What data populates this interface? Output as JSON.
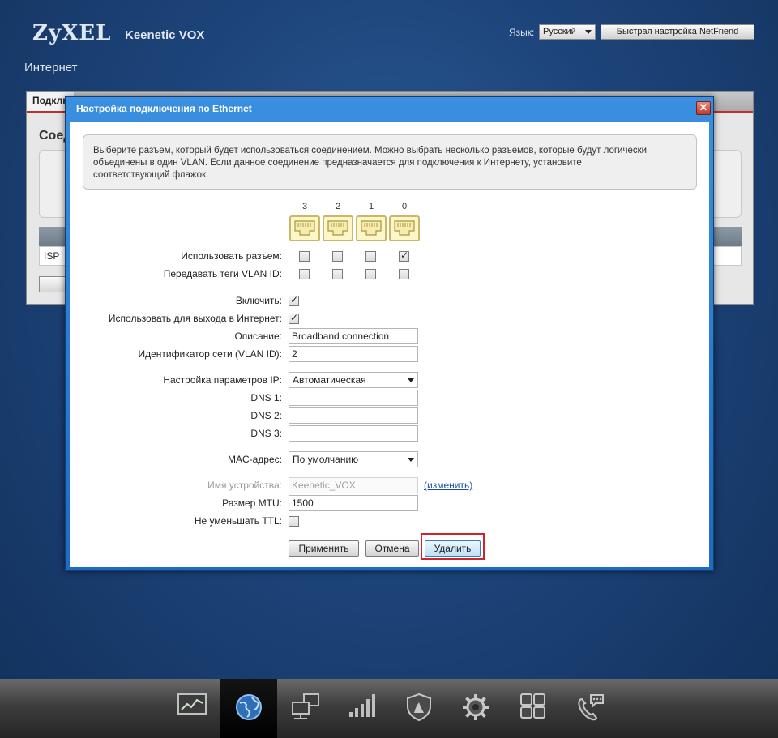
{
  "header": {
    "brand": "ZyXEL",
    "model": "Keenetic VOX",
    "language_label": "Язык:",
    "language_value": "Русский",
    "netfriend_button": "Быстрая настройка NetFriend",
    "page_title": "Интернет"
  },
  "background_panel": {
    "tab": "Подклю",
    "heading": "Соед",
    "table_row": "ISP"
  },
  "dialog": {
    "title": "Настройка подключения по Ethernet",
    "close": "✕",
    "info_lines": [
      "Выберите разъем, который будет использоваться соединением. Можно выбрать несколько разъемов, которые будут логически",
      "объединены в один VLAN. Если данное соединение предназначается для подключения к Интернету, установите",
      "соответствующий флажок."
    ],
    "ports": [
      "3",
      "2",
      "1",
      "0"
    ],
    "use_port_label": "Использовать разъем:",
    "use_port_checked": [
      false,
      false,
      false,
      true
    ],
    "vlan_tags_label": "Передавать теги VLAN ID:",
    "vlan_tags_checked": [
      false,
      false,
      false,
      false
    ],
    "enable_label": "Включить:",
    "enable_checked": true,
    "internet_label": "Использовать для выхода в Интернет:",
    "internet_checked": true,
    "description_label": "Описание:",
    "description_value": "Broadband connection",
    "vlan_id_label": "Идентификатор сети (VLAN ID):",
    "vlan_id_value": "2",
    "ip_settings_label": "Настройка параметров IP:",
    "ip_settings_value": "Автоматическая",
    "dns1_label": "DNS 1:",
    "dns2_label": "DNS 2:",
    "dns3_label": "DNS 3:",
    "dns1_value": "",
    "dns2_value": "",
    "dns3_value": "",
    "mac_label": "MAC-адрес:",
    "mac_value": "По умолчанию",
    "device_name_label": "Имя устройства:",
    "device_name_value": "Keenetic_VOX",
    "change_link": "(изменить)",
    "mtu_label": "Размер MTU:",
    "mtu_value": "1500",
    "ttl_label": "Не уменьшать TTL:",
    "ttl_checked": false,
    "apply_button": "Применить",
    "cancel_button": "Отмена",
    "delete_button": "Удалить"
  },
  "taskbar": {
    "items": [
      "monitor-icon",
      "globe-icon",
      "network-icon",
      "signal-icon",
      "shield-icon",
      "gear-icon",
      "apps-icon",
      "phone-icon"
    ],
    "active": "globe-icon"
  }
}
